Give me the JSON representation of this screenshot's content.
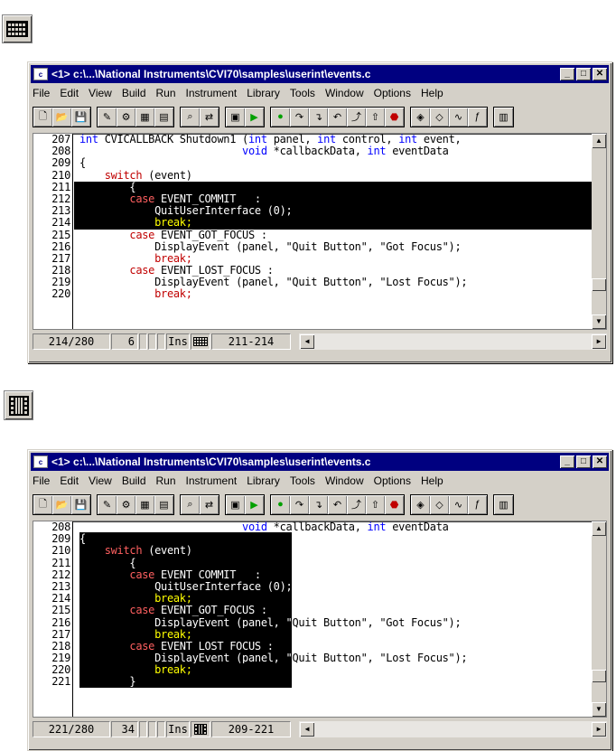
{
  "mode_icon_line": "line-selection-mode-icon",
  "mode_icon_column": "column-selection-mode-icon",
  "window1": {
    "title": "<1> c:\\...\\National Instruments\\CVI70\\samples\\userint\\events.c",
    "menu": [
      "File",
      "Edit",
      "View",
      "Build",
      "Run",
      "Instrument",
      "Library",
      "Tools",
      "Window",
      "Options",
      "Help"
    ],
    "line_numbers": [
      "207",
      "208",
      "209",
      "210",
      "211",
      "212",
      "213",
      "214",
      "215",
      "216",
      "217",
      "218",
      "219",
      "220"
    ],
    "status": {
      "position": "214/280",
      "column": "6",
      "ins": "Ins",
      "range": "211-214"
    }
  },
  "window2": {
    "title": "<1> c:\\...\\National Instruments\\CVI70\\samples\\userint\\events.c",
    "menu": [
      "File",
      "Edit",
      "View",
      "Build",
      "Run",
      "Instrument",
      "Library",
      "Tools",
      "Window",
      "Options",
      "Help"
    ],
    "line_numbers": [
      "208",
      "209",
      "210",
      "211",
      "212",
      "213",
      "214",
      "215",
      "216",
      "217",
      "218",
      "219",
      "220",
      "221"
    ],
    "status": {
      "position": "221/280",
      "column": "34",
      "ins": "Ins",
      "range": "209-221"
    }
  },
  "toolbar_icons": [
    "new-file-icon",
    "open-icon",
    "save-icon",
    "edit-icon",
    "tools-icon",
    "find-in-files-icon",
    "panel-icon",
    "find-icon",
    "replace-icon",
    "build-icon",
    "run-icon",
    "breakpoint-icon",
    "step-into-icon",
    "step-over-icon",
    "step-out-icon",
    "finish-icon",
    "up-icon",
    "stop-icon",
    "watch-icon",
    "variables-icon",
    "trace-icon",
    "function-panel-icon",
    "library-icon"
  ],
  "code1": [
    "int CVICALLBACK Shutdown1 (int panel, int control, int event,",
    "                          void *callbackData, int eventData",
    "{",
    "    switch (event)",
    "        {",
    "        case EVENT_COMMIT   :",
    "            QuitUserInterface (0);",
    "            break;",
    "        case EVENT_GOT_FOCUS :",
    "            DisplayEvent (panel, \"Quit Button\", \"Got Focus\");",
    "            break;",
    "        case EVENT_LOST_FOCUS :",
    "            DisplayEvent (panel, \"Quit Button\", \"Lost Focus\");",
    "            break;"
  ],
  "code2": [
    "                          void *callbackData, int eventData",
    "{",
    "    switch (event)",
    "        {",
    "        case EVENT_COMMIT   :",
    "            QuitUserInterface (0);",
    "            break;",
    "        case EVENT_GOT_FOCUS :",
    "            DisplayEvent (panel, \"Quit Button\", \"Got Focus\");",
    "            break;",
    "        case EVENT_LOST_FOCUS :",
    "            DisplayEvent (panel, \"Quit Button\", \"Lost Focus\");",
    "            break;",
    "        }"
  ]
}
